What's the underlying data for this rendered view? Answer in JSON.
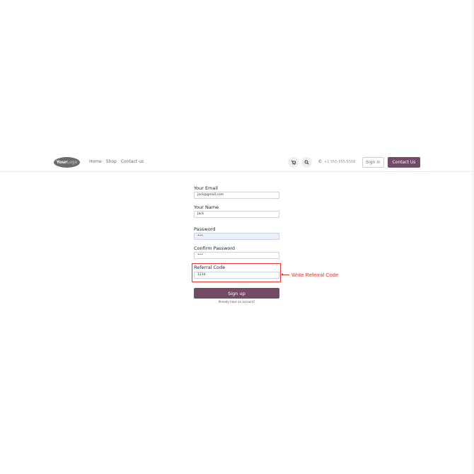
{
  "nav": {
    "logo_strong": "Your",
    "logo_light": "Logo",
    "links": [
      "Home",
      "Shop",
      "Contact us"
    ],
    "phone": "+1 555-555-5556",
    "sign_in": "Sign in",
    "contact_us": "Contact Us"
  },
  "icons": {
    "cart": "cart-icon",
    "search": "search-icon",
    "phone": "phone-icon"
  },
  "form": {
    "email_label": "Your Email",
    "email_value": "jack@gmail.com",
    "name_label": "Your Name",
    "name_value": "Jack",
    "password_label": "Password",
    "password_value": "•••",
    "confirm_label": "Confirm Password",
    "confirm_value": "•••",
    "referral_label": "Referral Code",
    "referral_value": "1234",
    "signup_button": "Sign up",
    "already_account": "Already have an account?"
  },
  "annotation": {
    "text": "Write Referral Code",
    "color": "#e53935"
  },
  "colors": {
    "brand": "#714b67",
    "autofill": "#e8f0fe"
  }
}
